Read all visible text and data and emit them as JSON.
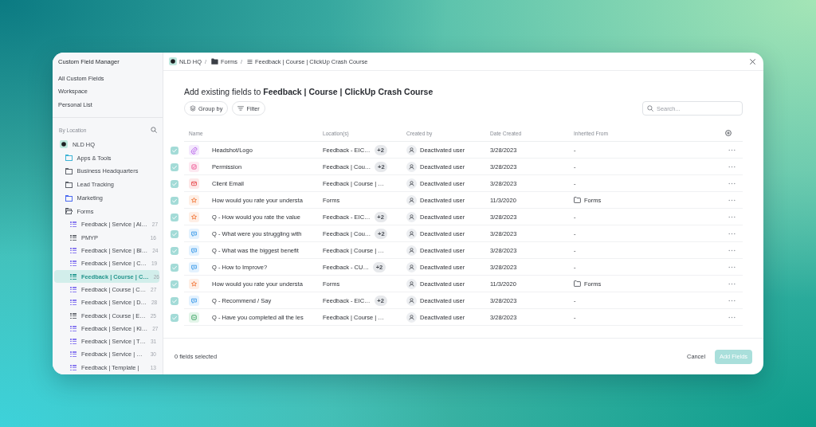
{
  "sidebar": {
    "title": "Custom Field Manager",
    "items": [
      {
        "label": "All Custom Fields",
        "selected": false
      },
      {
        "label": "Workspace",
        "selected": false
      },
      {
        "label": "Personal List",
        "selected": false
      }
    ],
    "location_heading": "By Location",
    "tree": [
      {
        "kind": "workspace",
        "label": "NLD HQ",
        "selected": false,
        "children": [
          {
            "kind": "folder",
            "label": "Apps & Tools",
            "color": "#3fb4d6",
            "selected": false,
            "expanded": false
          },
          {
            "kind": "folder",
            "label": "Business Headquarters",
            "color": "#5f636b",
            "selected": false,
            "expanded": false
          },
          {
            "kind": "folder",
            "label": "Lead Tracking",
            "color": "#5f636b",
            "selected": false,
            "expanded": false
          },
          {
            "kind": "folder",
            "label": "Marketing",
            "color": "#4c6bf0",
            "selected": false,
            "expanded": false
          },
          {
            "kind": "folder",
            "label": "Forms",
            "color": "#5f636b",
            "selected": false,
            "expanded": true,
            "children": [
              {
                "kind": "list",
                "label": "Feedback | Service | Al…",
                "count": "27",
                "color": "#8b7cf0",
                "selected": false
              },
              {
                "kind": "list",
                "label": "PMYP",
                "count": "16",
                "color": "#6b6f76",
                "selected": false
              },
              {
                "kind": "list",
                "label": "Feedback | Service | Bl…",
                "count": "24",
                "color": "#8b7cf0",
                "selected": false
              },
              {
                "kind": "list",
                "label": "Feedback | Service | C…",
                "count": "19",
                "color": "#8b7cf0",
                "selected": false
              },
              {
                "kind": "list",
                "label": "Feedback | Course | C…",
                "count": "26",
                "color": "#2a9d94",
                "selected": true
              },
              {
                "kind": "list",
                "label": "Feedback | Course | C…",
                "count": "27",
                "color": "#8b7cf0",
                "selected": false
              },
              {
                "kind": "list",
                "label": "Feedback | Service | D…",
                "count": "28",
                "color": "#8b7cf0",
                "selected": false
              },
              {
                "kind": "list",
                "label": "Feedback | Course | E…",
                "count": "25",
                "color": "#6b6f76",
                "selected": false
              },
              {
                "kind": "list",
                "label": "Feedback | Service | Ki…",
                "count": "27",
                "color": "#8b7cf0",
                "selected": false
              },
              {
                "kind": "list",
                "label": "Feedback | Service | T…",
                "count": "31",
                "color": "#8b7cf0",
                "selected": false
              },
              {
                "kind": "list",
                "label": "Feedback | Service | …",
                "count": "30",
                "color": "#8b7cf0",
                "selected": false
              },
              {
                "kind": "list",
                "label": "Feedback | Template |",
                "count": "13",
                "color": "#8b7cf0",
                "selected": false
              }
            ]
          }
        ]
      }
    ]
  },
  "breadcrumb": [
    {
      "kind": "workspace",
      "label": "NLD HQ",
      "separator": "/"
    },
    {
      "kind": "folder",
      "label": "Forms",
      "separator": "/"
    },
    {
      "kind": "list",
      "label": "Feedback | Course | ClickUp Crash Course"
    }
  ],
  "dialog": {
    "heading": "Add existing fields to **Feedback | Course | ClickUp Crash Course**",
    "toolbar": [
      {
        "kind": "group",
        "label": "Group by"
      },
      {
        "kind": "filter",
        "label": "Filter"
      }
    ],
    "search": {
      "placeholder": "Search..."
    }
  },
  "table": {
    "columns": [
      "Name",
      "Location(s)",
      "Created by",
      "Date Created",
      "Inherited From"
    ],
    "rows": [
      {
        "checked": true,
        "kind": "attachment",
        "name": "Headshot/Logo",
        "location": "Feedback - EIC…",
        "location_extra": "+2",
        "created_by": "Deactivated user",
        "date_created": "3/28/2023",
        "inherited_from": {
          "kind": "none",
          "label": "-"
        }
      },
      {
        "checked": true,
        "kind": "checkbox",
        "name": "Permission",
        "location": "Feedback | Cou…",
        "location_extra": "+2",
        "created_by": "Deactivated user",
        "date_created": "3/28/2023",
        "inherited_from": {
          "kind": "none",
          "label": "-"
        }
      },
      {
        "checked": true,
        "kind": "email",
        "name": "Client Email",
        "location": "Feedback | Course | …",
        "created_by": "Deactivated user",
        "date_created": "3/28/2023",
        "inherited_from": {
          "kind": "none",
          "label": "-"
        }
      },
      {
        "checked": true,
        "kind": "rating",
        "name": "How would you rate your understa",
        "location": "Forms",
        "created_by": "Deactivated user",
        "date_created": "11/3/2020",
        "inherited_from": {
          "kind": "folder",
          "label": "Forms"
        }
      },
      {
        "checked": true,
        "kind": "rating",
        "name": "Q - How would you rate the value",
        "location": "Feedback - EIC…",
        "location_extra": "+2",
        "created_by": "Deactivated user",
        "date_created": "3/28/2023",
        "inherited_from": {
          "kind": "none",
          "label": "-"
        }
      },
      {
        "checked": true,
        "kind": "text",
        "name": "Q - What were you struggling with",
        "location": "Feedback | Cou…",
        "location_extra": "+2",
        "created_by": "Deactivated user",
        "date_created": "3/28/2023",
        "inherited_from": {
          "kind": "none",
          "label": "-"
        }
      },
      {
        "checked": true,
        "kind": "text",
        "name": "Q - What was the biggest benefit",
        "location": "Feedback | Course | …",
        "created_by": "Deactivated user",
        "date_created": "3/28/2023",
        "inherited_from": {
          "kind": "none",
          "label": "-"
        }
      },
      {
        "checked": true,
        "kind": "text",
        "name": "Q - How to Improve?",
        "location": "Feedback - CU…",
        "location_extra": "+2",
        "created_by": "Deactivated user",
        "date_created": "3/28/2023",
        "inherited_from": {
          "kind": "none",
          "label": "-"
        }
      },
      {
        "checked": true,
        "kind": "rating",
        "name": "How would you rate your understa",
        "location": "Forms",
        "created_by": "Deactivated user",
        "date_created": "11/3/2020",
        "inherited_from": {
          "kind": "folder",
          "label": "Forms"
        }
      },
      {
        "checked": true,
        "kind": "text",
        "name": "Q - Recommend / Say",
        "location": "Feedback - EIC…",
        "location_extra": "+2",
        "created_by": "Deactivated user",
        "date_created": "3/28/2023",
        "inherited_from": {
          "kind": "none",
          "label": "-"
        }
      },
      {
        "checked": true,
        "kind": "dropdown",
        "name": "Q - Have you completed all the les",
        "location": "Feedback | Course | …",
        "created_by": "Deactivated user",
        "date_created": "3/28/2023",
        "inherited_from": {
          "kind": "none",
          "label": "-"
        }
      }
    ]
  },
  "footer": {
    "selection_summary": "0 fields selected",
    "buttons": [
      {
        "kind": "cancel",
        "label": "Cancel"
      },
      {
        "kind": "primary",
        "label": "Add Fields",
        "disabled": true
      }
    ]
  }
}
